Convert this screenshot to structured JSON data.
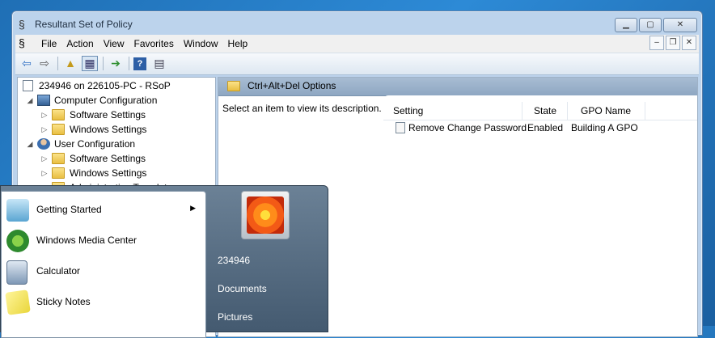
{
  "window": {
    "title": "Resultant Set of Policy",
    "caption_buttons": [
      "minimize",
      "maximize",
      "close"
    ]
  },
  "menu": {
    "items": [
      "File",
      "Action",
      "View",
      "Favorites",
      "Window",
      "Help"
    ]
  },
  "toolbar": {
    "buttons": [
      "back-icon",
      "forward-icon",
      "up-folder-icon",
      "show-tree-icon",
      "export-icon",
      "help-icon",
      "properties-icon"
    ]
  },
  "tree": {
    "root": "234946 on 226105-PC - RSoP",
    "computer_config": "Computer Configuration",
    "software_settings_1": "Software Settings",
    "windows_settings_1": "Windows Settings",
    "user_config": "User Configuration",
    "software_settings_2": "Software Settings",
    "windows_settings_2": "Windows Settings",
    "admin_templates": "Administrative Templates"
  },
  "details": {
    "header": "Ctrl+Alt+Del Options",
    "description": "Select an item to view its description.",
    "columns": [
      "Setting",
      "State",
      "GPO Name"
    ],
    "rows": [
      {
        "setting": "Remove Change Password",
        "state": "Enabled",
        "gpo": "Building A GPO"
      }
    ]
  },
  "start_menu": {
    "programs": [
      "Getting Started",
      "Windows Media Center",
      "Calculator",
      "Sticky Notes"
    ],
    "right_items": [
      "234946",
      "Documents",
      "Pictures"
    ]
  }
}
